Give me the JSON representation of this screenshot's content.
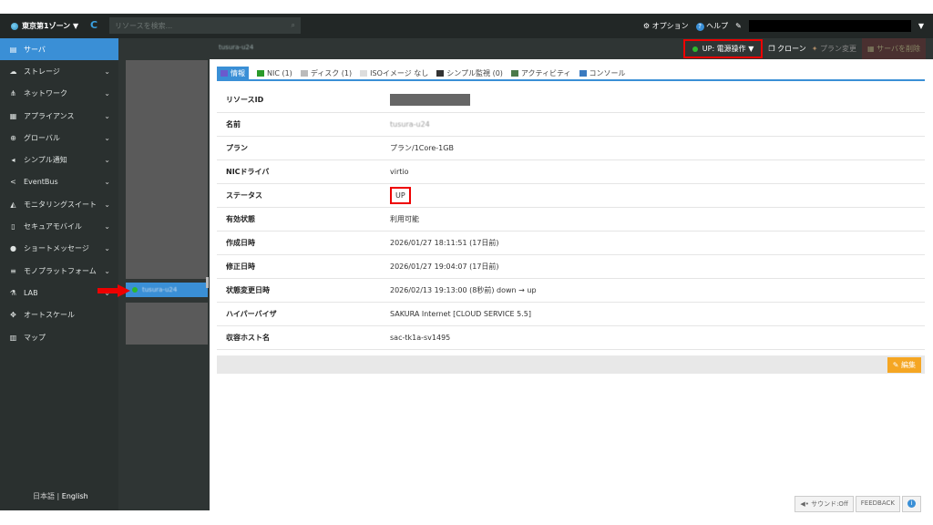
{
  "topbar": {
    "zone": "東京第1ゾーン ▼",
    "search_placeholder": "リソースを検索...",
    "option": "オプション",
    "help": "ヘルプ",
    "user_menu_caret": "▼"
  },
  "sidebar": {
    "items": [
      {
        "label": "サーバ",
        "icon": "server-icon",
        "active": true,
        "chev": false
      },
      {
        "label": "ストレージ",
        "icon": "storage-icon",
        "chev": true
      },
      {
        "label": "ネットワーク",
        "icon": "network-icon",
        "chev": true
      },
      {
        "label": "アプライアンス",
        "icon": "appliance-icon",
        "chev": true
      },
      {
        "label": "グローバル",
        "icon": "globe-icon",
        "chev": true
      },
      {
        "label": "シンプル通知",
        "icon": "megaphone-icon",
        "chev": true
      },
      {
        "label": "EventBus",
        "icon": "share-icon",
        "chev": true
      },
      {
        "label": "モニタリングスイート",
        "icon": "chart-icon",
        "chev": true
      },
      {
        "label": "セキュアモバイル",
        "icon": "mobile-icon",
        "chev": true
      },
      {
        "label": "ショートメッセージ",
        "icon": "chat-icon",
        "chev": true
      },
      {
        "label": "モノプラットフォーム",
        "icon": "list-icon",
        "chev": true
      },
      {
        "label": "LAB",
        "icon": "flask-icon",
        "chev": true
      },
      {
        "label": "オートスケール",
        "icon": "move-icon",
        "chev": false
      },
      {
        "label": "マップ",
        "icon": "map-icon",
        "chev": false
      }
    ],
    "lang_ja": "日本語",
    "lang_sep": "|",
    "lang_en": "English"
  },
  "server_list": {
    "selected": "tusura-u24",
    "status_color": "#2db82d"
  },
  "header": {
    "server_name": "tusura-u24",
    "power": "UP: 電源操作 ▼",
    "clone": "クローン",
    "plan_change": "プラン変更",
    "delete": "サーバを削除"
  },
  "tabs": [
    {
      "label": "情報",
      "active": true
    },
    {
      "label": "NIC (1)"
    },
    {
      "label": "ディスク (1)"
    },
    {
      "label": "ISOイメージ なし"
    },
    {
      "label": "シンプル監視 (0)"
    },
    {
      "label": "アクティビティ"
    },
    {
      "label": "コンソール"
    }
  ],
  "details": [
    {
      "k": "リソースID",
      "v": ""
    },
    {
      "k": "名前",
      "v": "tusura-u24"
    },
    {
      "k": "プラン",
      "v": "プラン/1Core-1GB"
    },
    {
      "k": "NICドライバ",
      "v": "virtio"
    },
    {
      "k": "ステータス",
      "v": "UP"
    },
    {
      "k": "有効状態",
      "v": "利用可能"
    },
    {
      "k": "作成日時",
      "v": "2026/01/27 18:11:51 (17日前)"
    },
    {
      "k": "修正日時",
      "v": "2026/01/27 19:04:07 (17日前)"
    },
    {
      "k": "状態変更日時",
      "v": "2026/02/13 19:13:00 (8秒前) down → up"
    },
    {
      "k": "ハイパーバイザ",
      "v": "SAKURA Internet [CLOUD SERVICE 5.5]"
    },
    {
      "k": "収容ホスト名",
      "v": "sac-tk1a-sv1495"
    }
  ],
  "edit": "編集",
  "bottom": {
    "sound": "サウンド:Off",
    "feedback": "FEEDBACK",
    "info": "i"
  }
}
